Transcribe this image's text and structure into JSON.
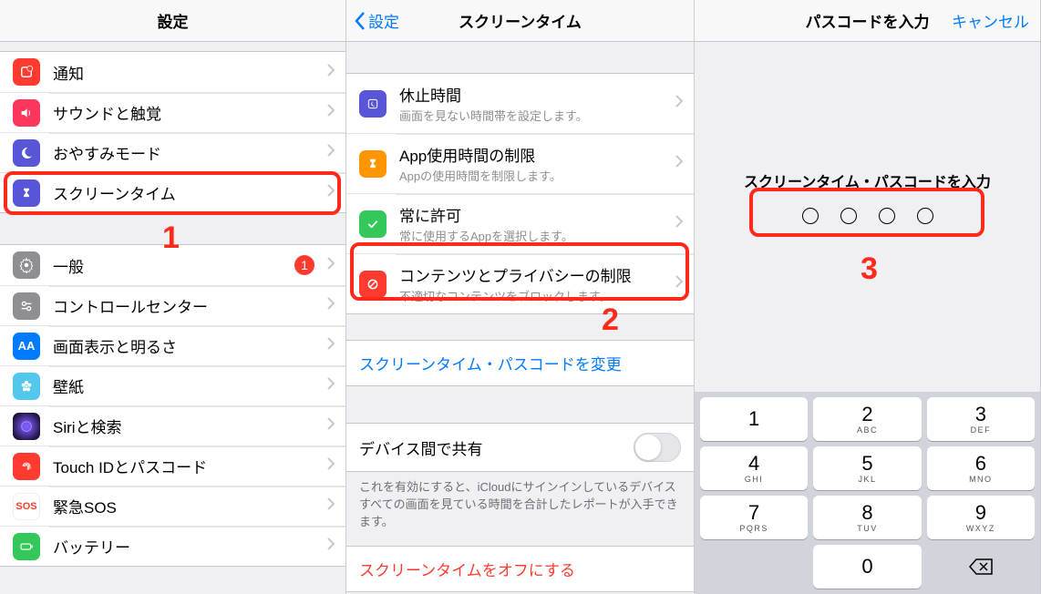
{
  "panel1": {
    "title": "設定",
    "group1": [
      {
        "icon": "notification",
        "bg": "#ff3b30",
        "label": "通知"
      },
      {
        "icon": "sound",
        "bg": "#ff2d55",
        "label": "サウンドと触覚"
      },
      {
        "icon": "moon",
        "bg": "#5856d6",
        "label": "おやすみモード"
      },
      {
        "icon": "hourglass",
        "bg": "#5856d6",
        "label": "スクリーンタイム"
      }
    ],
    "group2": [
      {
        "icon": "gear",
        "bg": "#8e8e93",
        "label": "一般",
        "badge": "1"
      },
      {
        "icon": "switches",
        "bg": "#8e8e93",
        "label": "コントロールセンター"
      },
      {
        "icon": "aa",
        "bg": "#007aff",
        "label": "画面表示と明るさ"
      },
      {
        "icon": "flower",
        "bg": "#54c7ec",
        "label": "壁紙"
      },
      {
        "icon": "siri",
        "bg": "#000000",
        "label": "Siriと検索"
      },
      {
        "icon": "fingerprint",
        "bg": "#ff3b30",
        "label": "Touch IDとパスコード"
      },
      {
        "icon": "sos",
        "bg": "#ffffff",
        "label": "緊急SOS"
      },
      {
        "icon": "battery",
        "bg": "#34c759",
        "label": "バッテリー"
      }
    ],
    "step_number": "1"
  },
  "panel2": {
    "back_label": "設定",
    "title": "スクリーンタイム",
    "items": [
      {
        "icon": "moon2",
        "bg": "#5856d6",
        "title": "休止時間",
        "sub": "画面を見ない時間帯を設定します。"
      },
      {
        "icon": "hourglass",
        "bg": "#ff9500",
        "title": "App使用時間の制限",
        "sub": "Appの使用時間を制限します。"
      },
      {
        "icon": "check",
        "bg": "#34c759",
        "title": "常に許可",
        "sub": "常に使用するAppを選択します。"
      },
      {
        "icon": "block",
        "bg": "#ff3b30",
        "title": "コンテンツとプライバシーの制限",
        "sub": "不適切なコンテンツをブロックします。"
      }
    ],
    "change_passcode": "スクリーンタイム・パスコードを変更",
    "share_label": "デバイス間で共有",
    "share_note": "これを有効にすると、iCloudにサインインしているデバイスすべての画面を見ている時間を合計したレポートが入手できます。",
    "turn_off": "スクリーンタイムをオフにする",
    "step_number": "2"
  },
  "panel3": {
    "title": "パスコードを入力",
    "cancel": "キャンセル",
    "prompt": "スクリーンタイム・パスコードを入力",
    "keys": [
      [
        {
          "n": "1",
          "l": ""
        },
        {
          "n": "2",
          "l": "ABC"
        },
        {
          "n": "3",
          "l": "DEF"
        }
      ],
      [
        {
          "n": "4",
          "l": "GHI"
        },
        {
          "n": "5",
          "l": "JKL"
        },
        {
          "n": "6",
          "l": "MNO"
        }
      ],
      [
        {
          "n": "7",
          "l": "PQRS"
        },
        {
          "n": "8",
          "l": "TUV"
        },
        {
          "n": "9",
          "l": "WXYZ"
        }
      ],
      [
        {
          "n": "",
          "l": "",
          "blank": true
        },
        {
          "n": "0",
          "l": ""
        },
        {
          "n": "",
          "l": "",
          "del": true
        }
      ]
    ],
    "step_number": "3"
  }
}
